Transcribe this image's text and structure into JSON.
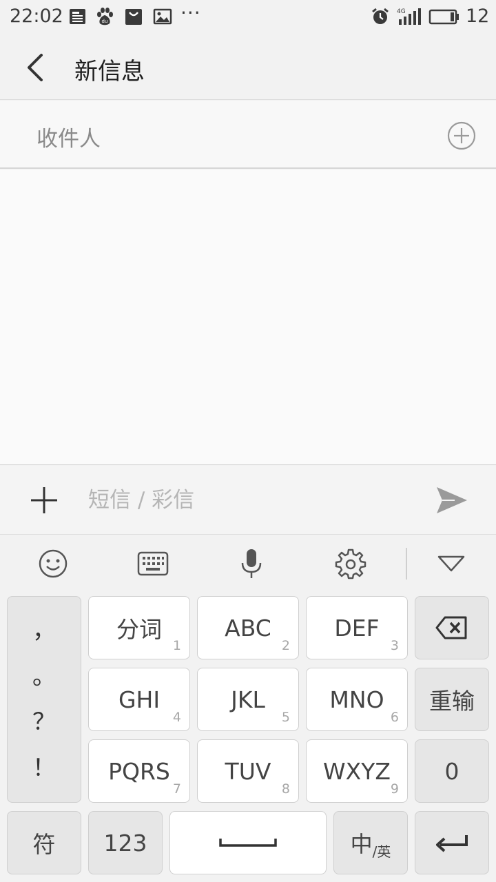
{
  "status_bar": {
    "time": "22:02",
    "icons": [
      "news-icon",
      "baidu-paw-icon",
      "shopping-bag-icon",
      "image-icon",
      "alarm-icon",
      "signal-4g-icon",
      "battery-icon"
    ],
    "more": "···",
    "battery_level": "12"
  },
  "header": {
    "title": "新信息",
    "back_icon": "chevron-left-icon"
  },
  "recipient": {
    "placeholder": "收件人",
    "add_icon": "plus-circle-icon"
  },
  "compose": {
    "placeholder": "短信 / 彩信",
    "attach_icon": "plus-icon",
    "send_icon": "send-icon"
  },
  "keyboard_toolbar": {
    "icons": [
      "smiley-icon",
      "keyboard-icon",
      "microphone-icon",
      "gear-icon",
      "triangle-down-icon"
    ]
  },
  "keyboard": {
    "punctuation": [
      "，",
      "。",
      "？",
      "！"
    ],
    "keys": [
      {
        "label": "分词",
        "num": "1"
      },
      {
        "label": "ABC",
        "num": "2"
      },
      {
        "label": "DEF",
        "num": "3"
      },
      {
        "label": "GHI",
        "num": "4"
      },
      {
        "label": "JKL",
        "num": "5"
      },
      {
        "label": "MNO",
        "num": "6"
      },
      {
        "label": "PQRS",
        "num": "7"
      },
      {
        "label": "TUV",
        "num": "8"
      },
      {
        "label": "WXYZ",
        "num": "9"
      }
    ],
    "reenter": "重输",
    "zero": "0",
    "symbols": "符",
    "numbers": "123",
    "lang_main": "中",
    "lang_sub": "/英",
    "backspace_icon": "backspace-icon",
    "space_icon": "space-bar-icon",
    "enter_icon": "enter-icon"
  }
}
